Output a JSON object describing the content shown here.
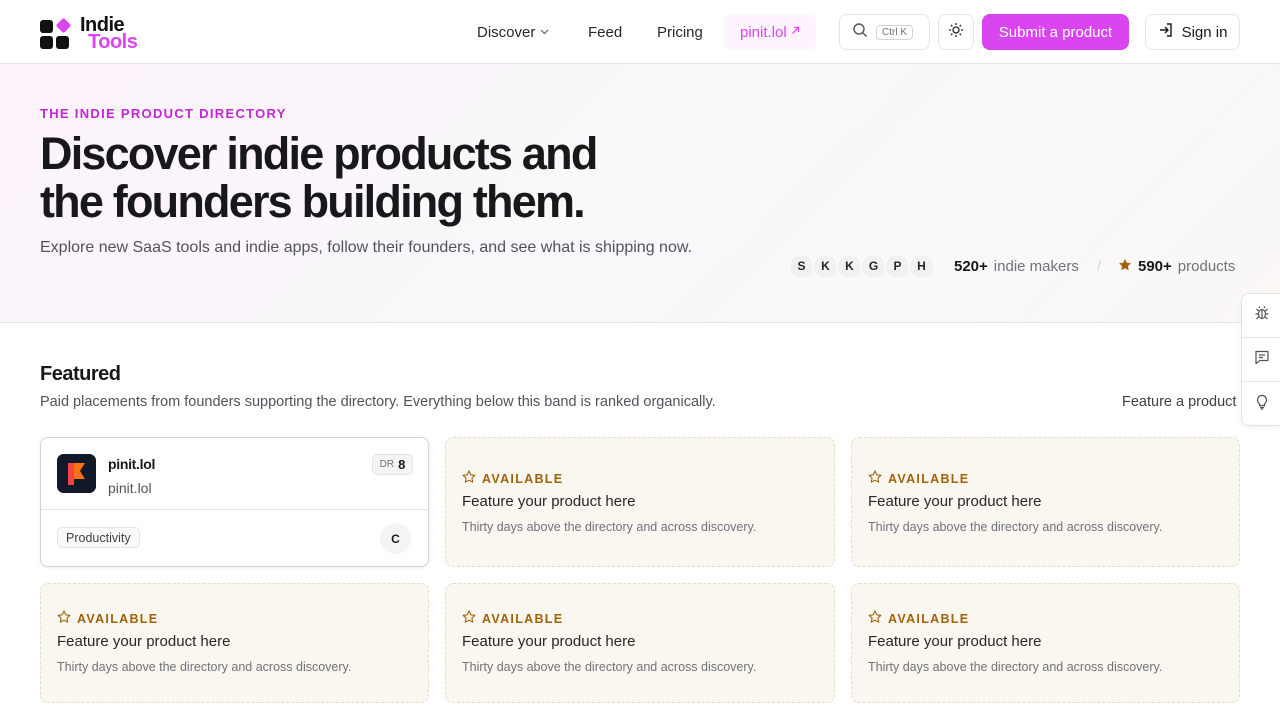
{
  "brand": {
    "line1": "Indie",
    "line2": "Tools"
  },
  "nav": {
    "discover": "Discover",
    "feed": "Feed",
    "pricing": "Pricing",
    "promo": "pinit.lol"
  },
  "search": {
    "shortcut": "Ctrl K"
  },
  "actions": {
    "submit": "Submit a product",
    "signin": "Sign in"
  },
  "hero": {
    "eyebrow": "THE INDIE PRODUCT DIRECTORY",
    "headline": "Discover indie products and the founders building them.",
    "subhead": "Explore new SaaS tools and indie apps, follow their founders, and see what is shipping now.",
    "avatars": [
      "S",
      "K",
      "K",
      "G",
      "P",
      "H"
    ],
    "makers_count": "520+",
    "makers_label": "indie makers",
    "separator": "/",
    "products_count": "590+",
    "products_label": "products"
  },
  "featured": {
    "title": "Featured",
    "subtitle": "Paid placements from founders supporting the directory. Everything below this band is ranked organically.",
    "link": "Feature a product",
    "product": {
      "name": "pinit.lol",
      "url": "pinit.lol",
      "dr_label": "DR",
      "dr_value": "8",
      "tag": "Productivity",
      "founder": "C"
    },
    "slot": {
      "badge": "AVAILABLE",
      "title": "Feature your product here",
      "desc": "Thirty days above the directory and across discovery."
    }
  },
  "colors": {
    "accent": "#d946ef",
    "available": "#a16207"
  },
  "icons": [
    "search-icon",
    "sun-icon",
    "sign-in-icon",
    "bug-icon",
    "message-icon",
    "lightbulb-icon",
    "star-icon",
    "external-link-icon",
    "chevron-down-icon"
  ]
}
